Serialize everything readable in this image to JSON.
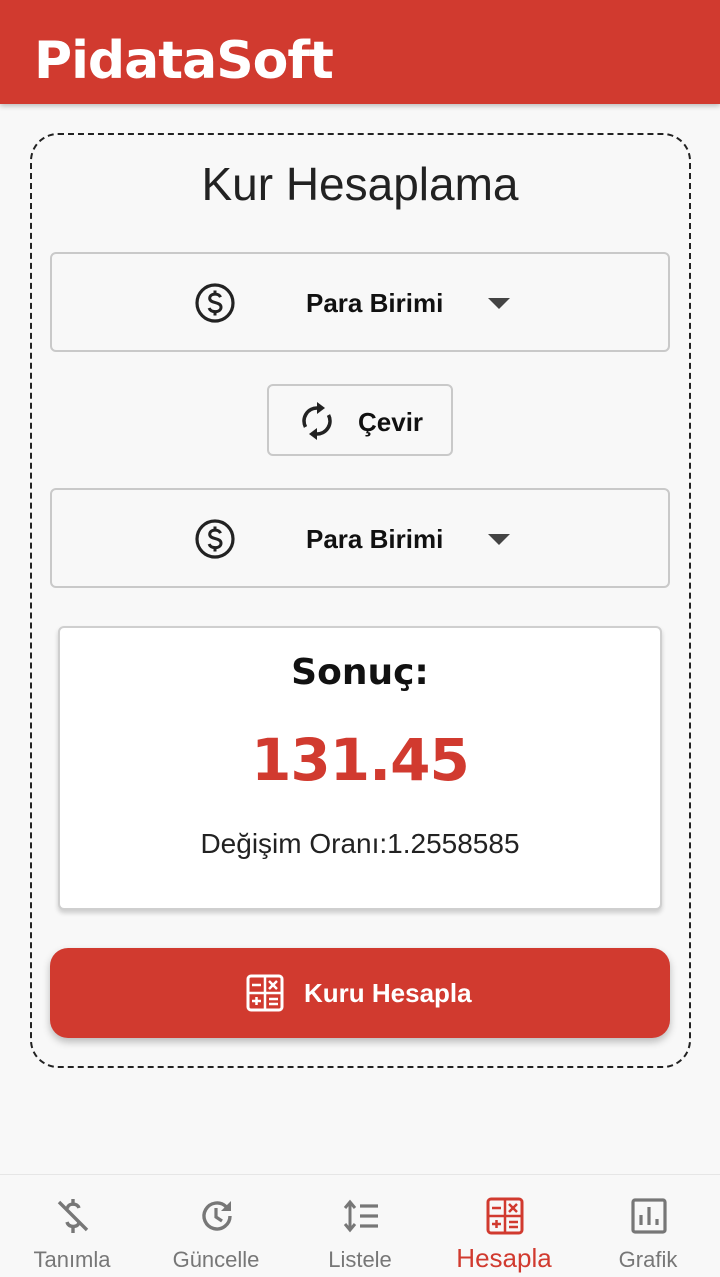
{
  "app": {
    "title": "PidataSoft"
  },
  "form": {
    "title": "Kur Hesaplama",
    "from_currency": {
      "label": "Para Birimi",
      "icon": "dollar-circle-icon"
    },
    "swap_button": {
      "label": "Çevir",
      "icon": "swap-refresh-icon"
    },
    "to_currency": {
      "label": "Para Birimi",
      "icon": "dollar-circle-icon"
    },
    "result": {
      "label": "Sonuç:",
      "value": "131.45",
      "rate": "Değişim Oranı:1.2558585"
    },
    "calculate_button": {
      "label": "Kuru Hesapla",
      "icon": "calculator-icon"
    }
  },
  "nav": {
    "items": [
      {
        "label": "Tanımla",
        "icon": "money-off-icon"
      },
      {
        "label": "Güncelle",
        "icon": "history-icon"
      },
      {
        "label": "Listele",
        "icon": "sort-list-icon"
      },
      {
        "label": "Hesapla",
        "icon": "calculator-icon",
        "active": true
      },
      {
        "label": "Grafik",
        "icon": "bar-chart-icon"
      }
    ]
  },
  "colors": {
    "primary": "#d13a2f",
    "background": "#f8f8f8",
    "inactive": "#777777"
  }
}
